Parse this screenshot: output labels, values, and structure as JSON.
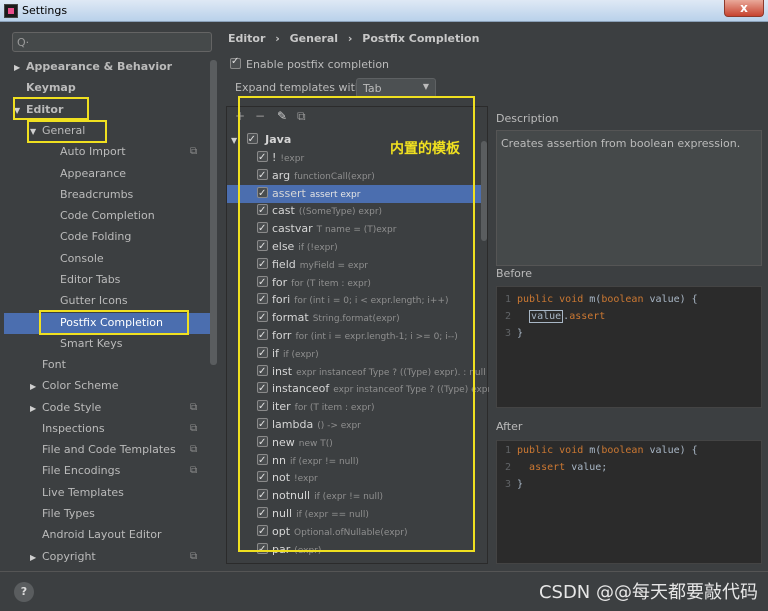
{
  "window": {
    "title": "Settings",
    "close_label": "x"
  },
  "search": {
    "placeholder": "Q·"
  },
  "sidebar": {
    "items": [
      {
        "label": "Appearance & Behavior",
        "level": 0,
        "arrow": "▶",
        "bold": true
      },
      {
        "label": "Keymap",
        "level": 0,
        "arrow": "",
        "bold": true
      },
      {
        "label": "Editor",
        "level": 0,
        "arrow": "▼",
        "bold": true
      },
      {
        "label": "General",
        "level": 1,
        "arrow": "▼",
        "bold": false
      },
      {
        "label": "Auto Import",
        "level": 2,
        "arrow": "",
        "bold": false,
        "copy": true
      },
      {
        "label": "Appearance",
        "level": 2,
        "arrow": "",
        "bold": false
      },
      {
        "label": "Breadcrumbs",
        "level": 2,
        "arrow": "",
        "bold": false
      },
      {
        "label": "Code Completion",
        "level": 2,
        "arrow": "",
        "bold": false
      },
      {
        "label": "Code Folding",
        "level": 2,
        "arrow": "",
        "bold": false
      },
      {
        "label": "Console",
        "level": 2,
        "arrow": "",
        "bold": false
      },
      {
        "label": "Editor Tabs",
        "level": 2,
        "arrow": "",
        "bold": false
      },
      {
        "label": "Gutter Icons",
        "level": 2,
        "arrow": "",
        "bold": false
      },
      {
        "label": "Postfix Completion",
        "level": 2,
        "arrow": "",
        "bold": false,
        "selected": true
      },
      {
        "label": "Smart Keys",
        "level": 2,
        "arrow": "",
        "bold": false
      },
      {
        "label": "Font",
        "level": 1,
        "arrow": "",
        "bold": false
      },
      {
        "label": "Color Scheme",
        "level": 1,
        "arrow": "▶",
        "bold": false
      },
      {
        "label": "Code Style",
        "level": 1,
        "arrow": "▶",
        "bold": false,
        "copy": true
      },
      {
        "label": "Inspections",
        "level": 1,
        "arrow": "",
        "bold": false,
        "copy": true
      },
      {
        "label": "File and Code Templates",
        "level": 1,
        "arrow": "",
        "bold": false,
        "copy": true
      },
      {
        "label": "File Encodings",
        "level": 1,
        "arrow": "",
        "bold": false,
        "copy": true
      },
      {
        "label": "Live Templates",
        "level": 1,
        "arrow": "",
        "bold": false
      },
      {
        "label": "File Types",
        "level": 1,
        "arrow": "",
        "bold": false
      },
      {
        "label": "Android Layout Editor",
        "level": 1,
        "arrow": "",
        "bold": false
      },
      {
        "label": "Copyright",
        "level": 1,
        "arrow": "▶",
        "bold": false,
        "copy": true
      }
    ]
  },
  "breadcrumb": [
    "Editor",
    "›",
    "General",
    "›",
    "Postfix Completion"
  ],
  "enable": {
    "label": "Enable postfix completion",
    "checked": true
  },
  "expand": {
    "label": "Expand templates with",
    "value": "Tab"
  },
  "toolbar": {
    "add": "+",
    "remove": "−",
    "edit": "✎",
    "copy": "⧉"
  },
  "templates": {
    "group": "Java",
    "items": [
      {
        "name": "!",
        "desc": "!expr"
      },
      {
        "name": "arg",
        "desc": "functionCall(expr)"
      },
      {
        "name": "assert",
        "desc": "assert expr",
        "selected": true
      },
      {
        "name": "cast",
        "desc": "((SomeType) expr)"
      },
      {
        "name": "castvar",
        "desc": "T name = (T)expr"
      },
      {
        "name": "else",
        "desc": "if (!expr)"
      },
      {
        "name": "field",
        "desc": "myField = expr"
      },
      {
        "name": "for",
        "desc": "for (T item : expr)"
      },
      {
        "name": "fori",
        "desc": "for (int i = 0; i < expr.length; i++)"
      },
      {
        "name": "format",
        "desc": "String.format(expr)"
      },
      {
        "name": "forr",
        "desc": "for (int i = expr.length-1; i >= 0; i--)"
      },
      {
        "name": "if",
        "desc": "if (expr)"
      },
      {
        "name": "inst",
        "desc": "expr instanceof Type ? ((Type) expr). : null"
      },
      {
        "name": "instanceof",
        "desc": "expr instanceof Type ? ((Type) expr)"
      },
      {
        "name": "iter",
        "desc": "for (T item : expr)"
      },
      {
        "name": "lambda",
        "desc": "() -> expr"
      },
      {
        "name": "new",
        "desc": "new T()"
      },
      {
        "name": "nn",
        "desc": "if (expr != null)"
      },
      {
        "name": "not",
        "desc": "!expr"
      },
      {
        "name": "notnull",
        "desc": "if (expr != null)"
      },
      {
        "name": "null",
        "desc": "if (expr == null)"
      },
      {
        "name": "opt",
        "desc": "Optional.ofNullable(expr)"
      },
      {
        "name": "par",
        "desc": "(expr)"
      }
    ]
  },
  "annotation": {
    "text": "内置的模板",
    "color": "#f0e020"
  },
  "description": {
    "label": "Description",
    "text": "Creates assertion from boolean expression."
  },
  "before": {
    "label": "Before",
    "line1_kw1": "public",
    "line1_kw2": "void",
    "line1_rest": "m(",
    "line1_kw3": "boolean",
    "line1_tail": "value) {",
    "line2_var": "value",
    "line2_dot": ".",
    "line2_pf": "assert",
    "line3": "}"
  },
  "after": {
    "label": "After",
    "line1_kw1": "public",
    "line1_kw2": "void",
    "line1_rest": "m(",
    "line1_kw3": "boolean",
    "line1_tail": "value) {",
    "line2_kw": "assert",
    "line2_rest": "value;",
    "line3": "}"
  },
  "line_numbers": [
    "1",
    "2",
    "3"
  ],
  "help": "?",
  "watermark": "CSDN @@每天都要敲代码",
  "colors": {
    "selection": "#4b6eaf",
    "annotation": "#f0e020",
    "keyword": "#cc7832"
  }
}
